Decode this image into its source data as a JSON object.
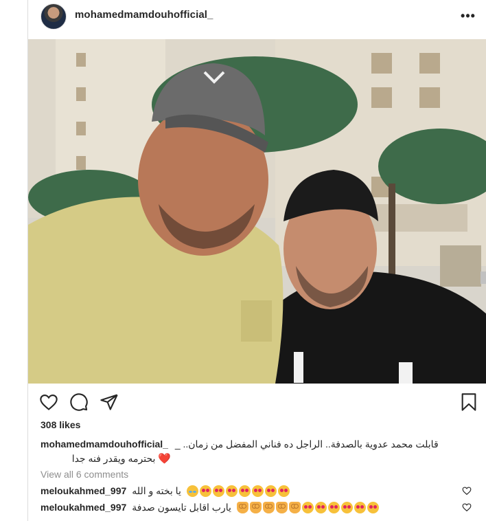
{
  "post": {
    "username": "mohamedmamdouhofficial_",
    "more_icon": "more-horizontal-icon",
    "photo_alt": "",
    "likes": "308 likes",
    "caption": {
      "user": "mohamedmamdouhofficial_",
      "line1": "قابلت محمد عدوية بالصدفة.. الراجل ده فناني المفضل من زمان.. _",
      "line2": "بحترمه ويقدر فنه جدا",
      "heart": "❤️"
    },
    "view_all": "View all 6 comments",
    "comments": [
      {
        "user": "meloukahmed_997",
        "text": "يا بخته و الله",
        "emoji_count": 8
      },
      {
        "user": "meloukahmed_997",
        "text": "يارب اقابل تايسون صدفة",
        "emoji_count": 11
      }
    ]
  },
  "colors": {
    "text": "#262626",
    "muted": "#8e8e8e",
    "border": "#dbdbdb",
    "heart": "#e0245e"
  }
}
